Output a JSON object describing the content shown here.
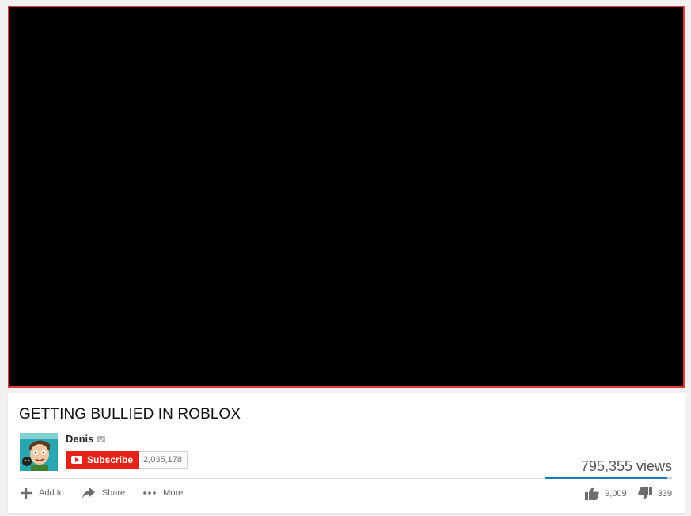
{
  "video": {
    "title": "GETTING BULLIED IN ROBLOX",
    "views": "795,355 views",
    "like_ratio": 0.964
  },
  "channel": {
    "name": "Denis",
    "subscribe_label": "Subscribe",
    "subscriber_count": "2,035,178"
  },
  "actions": {
    "add_to": "Add to",
    "share": "Share",
    "more": "More"
  },
  "ratings": {
    "likes": "9,009",
    "dislikes": "339"
  },
  "colors": {
    "subscribe": "#e62117",
    "like_bar": "#167ac6",
    "player_border": "#e53935"
  },
  "icons": {
    "add": "plus-icon",
    "share": "share-arrow-icon",
    "more": "ellipsis-icon",
    "like": "thumbs-up-icon",
    "dislike": "thumbs-down-icon",
    "verified": "verified-check-icon",
    "youtube": "youtube-logo-icon"
  }
}
